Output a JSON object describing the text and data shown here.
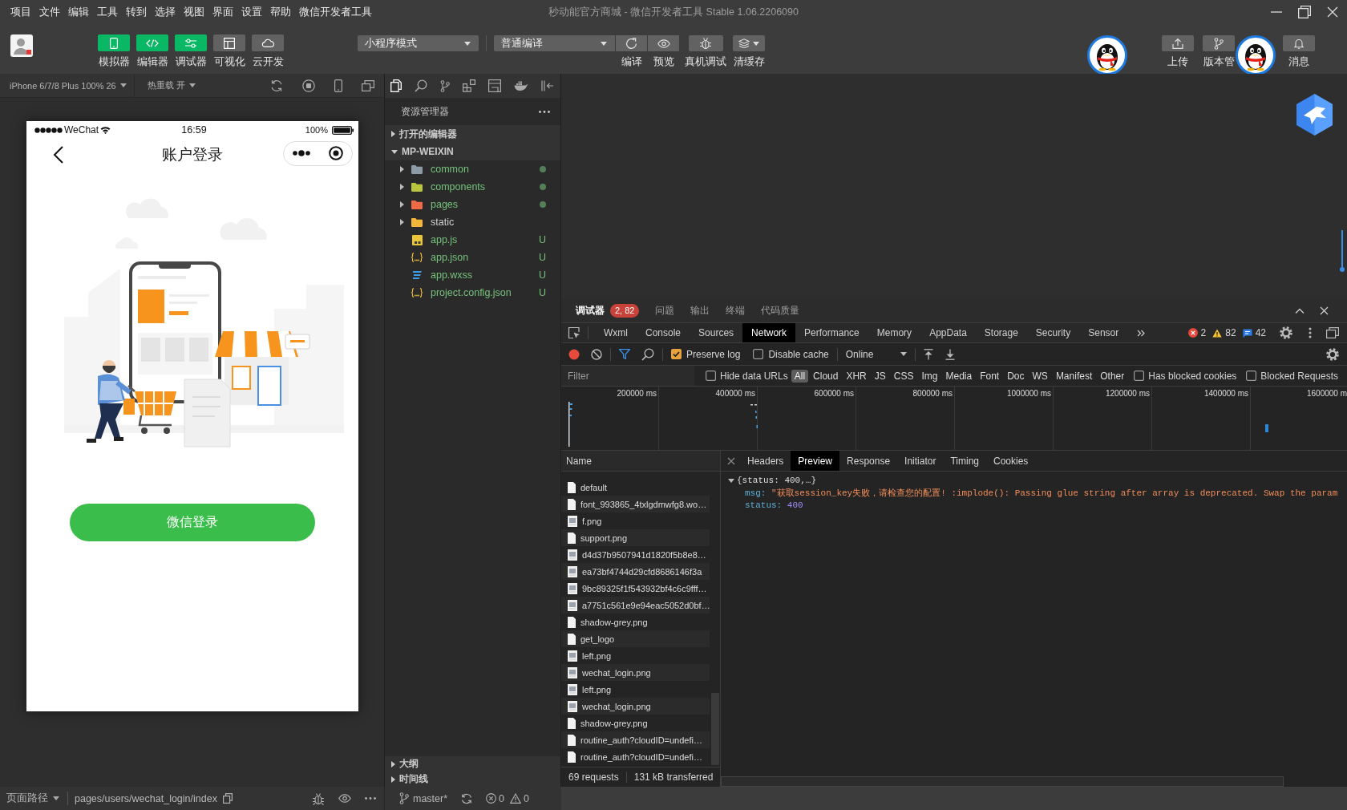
{
  "menu_bar": {
    "items": [
      "项目",
      "文件",
      "编辑",
      "工具",
      "转到",
      "选择",
      "视图",
      "界面",
      "设置",
      "帮助",
      "微信开发者工具"
    ],
    "title": "秒动能官方商城 - 微信开发者工具 Stable 1.06.2206090"
  },
  "toolbar": {
    "modes": [
      {
        "kind": "simulator",
        "label": "模拟器",
        "on": true
      },
      {
        "kind": "editor",
        "label": "编辑器",
        "on": true
      },
      {
        "kind": "debugger",
        "label": "调试器",
        "on": true
      },
      {
        "kind": "visual",
        "label": "可视化",
        "on": false
      },
      {
        "kind": "cloud",
        "label": "云开发",
        "on": false
      }
    ],
    "app_mode": "小程序模式",
    "compile_mode": "普通编译",
    "actions": [
      {
        "kind": "compile",
        "label": "编译"
      },
      {
        "kind": "preview",
        "label": "预览"
      },
      {
        "kind": "remote_debug",
        "label": "真机调试"
      },
      {
        "kind": "clear_cache",
        "label": "清缓存"
      }
    ],
    "account_actions": [
      {
        "kind": "upload",
        "label": "上传"
      },
      {
        "kind": "version",
        "label": "版本管"
      },
      {
        "kind": "messages",
        "label": "消息"
      }
    ]
  },
  "simulator": {
    "device": "iPhone 6/7/8 Plus 100% 26",
    "hot_reload": "热重载 开",
    "phone": {
      "carrier": "WeChat",
      "time": "16:59",
      "battery": "100%",
      "title": "账户登录",
      "login_button": "微信登录"
    }
  },
  "explorer": {
    "title": "资源管理器",
    "sections": [
      {
        "label": "打开的编辑器",
        "expanded": false
      },
      {
        "label": "MP-WEIXIN",
        "expanded": true,
        "children": [
          {
            "name": "common",
            "kind": "folder",
            "color": "#8d9ba7",
            "expanded": false,
            "changed": true
          },
          {
            "name": "components",
            "kind": "folder",
            "color": "#b9c53c",
            "expanded": false,
            "changed": true
          },
          {
            "name": "pages",
            "kind": "folder",
            "color": "#ef6a47",
            "expanded": false,
            "changed": true
          },
          {
            "name": "static",
            "kind": "folder",
            "color": "#f3b63b",
            "expanded": false,
            "changed": false
          },
          {
            "name": "app.js",
            "kind": "js",
            "changed": true,
            "badge": "U"
          },
          {
            "name": "app.json",
            "kind": "json",
            "changed": true,
            "badge": "U"
          },
          {
            "name": "app.wxss",
            "kind": "css",
            "changed": true,
            "badge": "U"
          },
          {
            "name": "project.config.json",
            "kind": "json",
            "changed": true,
            "badge": "U"
          }
        ]
      }
    ],
    "panels": [
      {
        "label": "大纲",
        "expanded": false
      },
      {
        "label": "时间线",
        "expanded": false
      }
    ]
  },
  "debugger": {
    "panels": [
      {
        "label": "调试器",
        "selected": true,
        "badge": "2, 82"
      },
      {
        "label": "问题",
        "selected": false
      },
      {
        "label": "输出",
        "selected": false
      },
      {
        "label": "终端",
        "selected": false
      },
      {
        "label": "代码质量",
        "selected": false
      }
    ],
    "tabs": [
      {
        "label": "Wxml",
        "selected": false
      },
      {
        "label": "Console",
        "selected": false
      },
      {
        "label": "Sources",
        "selected": false
      },
      {
        "label": "Network",
        "selected": true
      },
      {
        "label": "Performance",
        "selected": false
      },
      {
        "label": "Memory",
        "selected": false
      },
      {
        "label": "AppData",
        "selected": false
      },
      {
        "label": "Storage",
        "selected": false
      },
      {
        "label": "Security",
        "selected": false
      },
      {
        "label": "Sensor",
        "selected": false
      }
    ],
    "counts": {
      "errors": "2",
      "warnings": "82",
      "messages": "42"
    },
    "network": {
      "recording": true,
      "filter_active": true,
      "preserve_log": {
        "label": "Preserve log",
        "checked": true
      },
      "disable_cache": {
        "label": "Disable cache",
        "checked": false
      },
      "throttling": "Online",
      "filter": {
        "placeholder": "Filter",
        "hide_data_urls": {
          "label": "Hide data URLs",
          "checked": false
        },
        "types": [
          {
            "label": "All",
            "selected": true
          },
          {
            "label": "Cloud",
            "selected": false
          },
          {
            "label": "XHR",
            "selected": false
          },
          {
            "label": "JS",
            "selected": false
          },
          {
            "label": "CSS",
            "selected": false
          },
          {
            "label": "Img",
            "selected": false
          },
          {
            "label": "Media",
            "selected": false
          },
          {
            "label": "Font",
            "selected": false
          },
          {
            "label": "Doc",
            "selected": false
          },
          {
            "label": "WS",
            "selected": false
          },
          {
            "label": "Manifest",
            "selected": false
          },
          {
            "label": "Other",
            "selected": false
          }
        ],
        "has_blocked_cookies": {
          "label": "Has blocked cookies",
          "checked": false
        },
        "blocked_requests": {
          "label": "Blocked Requests",
          "checked": false
        }
      },
      "overview_ticks": [
        "200000 ms",
        "400000 ms",
        "600000 ms",
        "800000 ms",
        "1000000 ms",
        "1200000 ms",
        "1400000 ms",
        "1600000 m"
      ],
      "name_column": "Name",
      "requests": [
        {
          "name": "default",
          "kind": "document"
        },
        {
          "name": "font_993865_4txlgdmwfg8.wo…",
          "kind": "document"
        },
        {
          "name": "f.png",
          "kind": "image"
        },
        {
          "name": "support.png",
          "kind": "document"
        },
        {
          "name": "d4d37b9507941d1820f5b8e8…",
          "kind": "image"
        },
        {
          "name": "ea73bf4744d29cfd8686146f3a",
          "kind": "image"
        },
        {
          "name": "9bc89325f1f543932bf4c6c9fff…",
          "kind": "image"
        },
        {
          "name": "a7751c561e9e94eac5052d0bf…",
          "kind": "image"
        },
        {
          "name": "shadow-grey.png",
          "kind": "document"
        },
        {
          "name": "get_logo",
          "kind": "document"
        },
        {
          "name": "left.png",
          "kind": "image"
        },
        {
          "name": "wechat_login.png",
          "kind": "image"
        },
        {
          "name": "left.png",
          "kind": "image"
        },
        {
          "name": "wechat_login.png",
          "kind": "image"
        },
        {
          "name": "shadow-grey.png",
          "kind": "document"
        },
        {
          "name": "routine_auth?cloudID=undefi…",
          "kind": "document"
        },
        {
          "name": "routine_auth?cloudID=undefi…",
          "kind": "document"
        }
      ],
      "summary": [
        "69 requests",
        "131 kB transferred"
      ],
      "detail_tabs": [
        {
          "label": "Headers",
          "selected": false
        },
        {
          "label": "Preview",
          "selected": true
        },
        {
          "label": "Response",
          "selected": false
        },
        {
          "label": "Initiator",
          "selected": false
        },
        {
          "label": "Timing",
          "selected": false
        },
        {
          "label": "Cookies",
          "selected": false
        }
      ],
      "preview": {
        "summary": "{status: 400,…}",
        "expanded": true,
        "fields": [
          {
            "key": "msg:",
            "kind": "string",
            "value": "\"获取session_key失败，请检查您的配置! :implode(): Passing glue string after array is deprecated. Swap the param"
          },
          {
            "key": "status:",
            "kind": "number",
            "value": "400"
          }
        ]
      }
    }
  },
  "status_bar": {
    "path_label": "页面路径",
    "path": "pages/users/wechat_login/index",
    "branch": "master*",
    "errors": "0",
    "warnings": "0"
  }
}
